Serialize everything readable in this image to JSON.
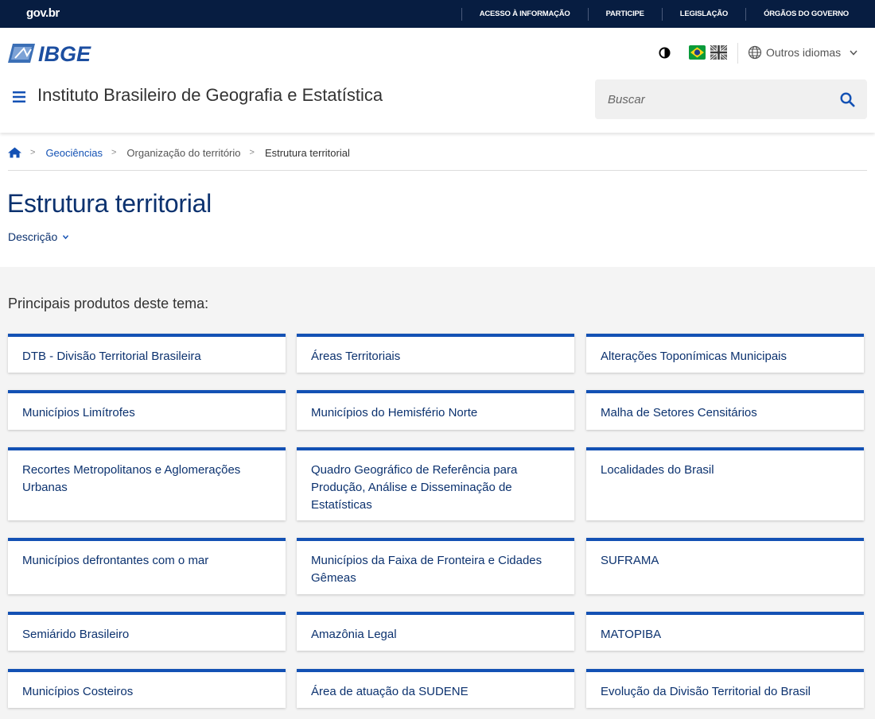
{
  "govbar": {
    "logo": "gov.br",
    "links": [
      "ACESSO À INFORMAÇÃO",
      "PARTICIPE",
      "LEGISLAÇÃO",
      "ÓRGÃOS DO GOVERNO"
    ]
  },
  "header": {
    "logo_text": "IBGE",
    "site_title": "Instituto Brasileiro de Geografia e Estatística",
    "language_label": "Outros idiomas",
    "search_placeholder": "Buscar"
  },
  "breadcrumb": {
    "items": [
      "Geociências",
      "Organização do território",
      "Estrutura territorial"
    ]
  },
  "page": {
    "title": "Estrutura territorial",
    "description_toggle": "Descrição"
  },
  "products": {
    "heading": "Principais produtos deste tema:",
    "items": [
      "DTB - Divisão Territorial Brasileira",
      "Áreas Territoriais",
      "Alterações Toponímicas Municipais",
      "Municípios Limítrofes",
      "Municípios do Hemisfério Norte",
      "Malha de Setores Censitários",
      "Recortes Metropolitanos e Aglomerações Urbanas",
      "Quadro Geográfico de Referência para Produção, Análise e Disseminação de Estatísticas",
      "Localidades do Brasil",
      "Municípios defrontantes com o mar",
      "Municípios da Faixa de Fronteira e Cidades Gêmeas",
      "SUFRAMA",
      "Semiárido Brasileiro",
      "Amazônia Legal",
      "MATOPIBA",
      "Municípios Costeiros",
      "Área de atuação da SUDENE",
      "Evolução da Divisão Territorial do Brasil"
    ]
  },
  "colors": {
    "govbar_bg": "#071d41",
    "primary_blue": "#1351b4",
    "title_blue": "#0c326f",
    "section_bg": "#f4f4f4"
  }
}
